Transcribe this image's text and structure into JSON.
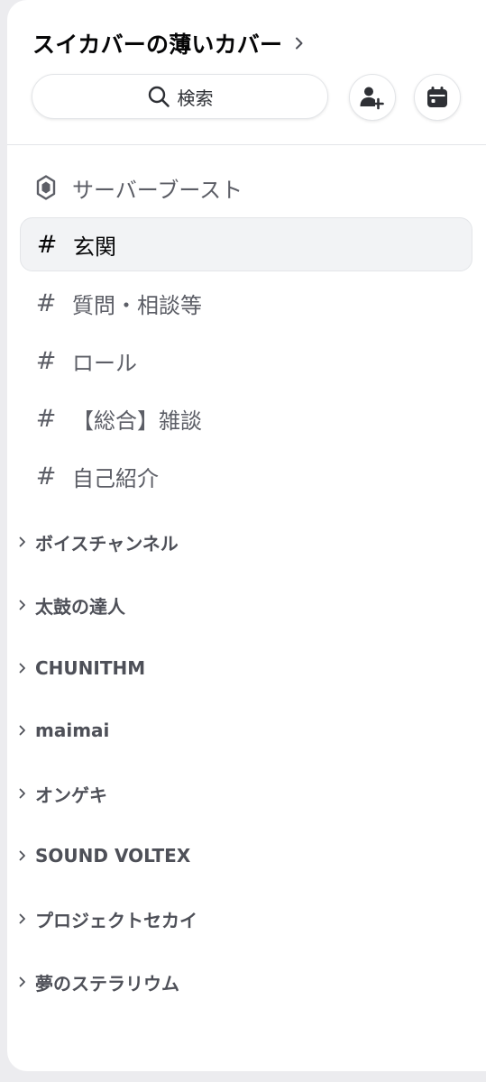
{
  "server": {
    "name": "スイカバーの薄いカバー"
  },
  "toolbar": {
    "search_label": "検索",
    "invite_icon": "add-member-icon",
    "events_icon": "calendar-icon"
  },
  "channels": [
    {
      "label": "サーバーブースト",
      "icon": "boost-icon",
      "selected": false
    },
    {
      "label": "玄関",
      "icon": "hash-icon",
      "selected": true
    },
    {
      "label": "質問・相談等",
      "icon": "hash-icon",
      "selected": false
    },
    {
      "label": "ロール",
      "icon": "hash-icon",
      "selected": false
    },
    {
      "label": "【総合】雑談",
      "icon": "hash-icon",
      "selected": false
    },
    {
      "label": "自己紹介",
      "icon": "hash-icon",
      "selected": false
    }
  ],
  "categories": [
    {
      "label": "ボイスチャンネル"
    },
    {
      "label": "太鼓の達人"
    },
    {
      "label": "CHUNITHM"
    },
    {
      "label": "maimai"
    },
    {
      "label": "オンゲキ"
    },
    {
      "label": "SOUND VOLTEX"
    },
    {
      "label": "プロジェクトセカイ"
    },
    {
      "label": "夢のステラリウム"
    }
  ],
  "colors": {
    "text_primary": "#060607",
    "text_muted": "#5c5e66",
    "selected_bg": "#f2f3f5",
    "background": "#ececef"
  }
}
